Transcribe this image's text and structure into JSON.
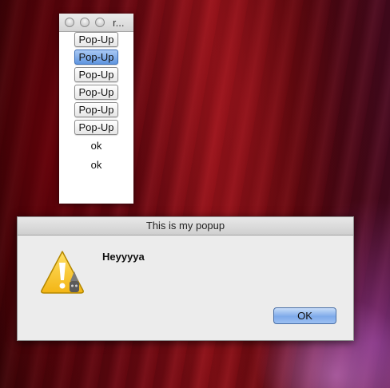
{
  "small_window": {
    "title": "r...",
    "popup_buttons": [
      "Pop-Up",
      "Pop-Up",
      "Pop-Up",
      "Pop-Up",
      "Pop-Up",
      "Pop-Up"
    ],
    "selected_index": 1,
    "labels": [
      "ok",
      "ok"
    ]
  },
  "dialog": {
    "title": "This is my popup",
    "message": "Heyyyya",
    "icon": "warning-icon",
    "ok_label": "OK"
  }
}
